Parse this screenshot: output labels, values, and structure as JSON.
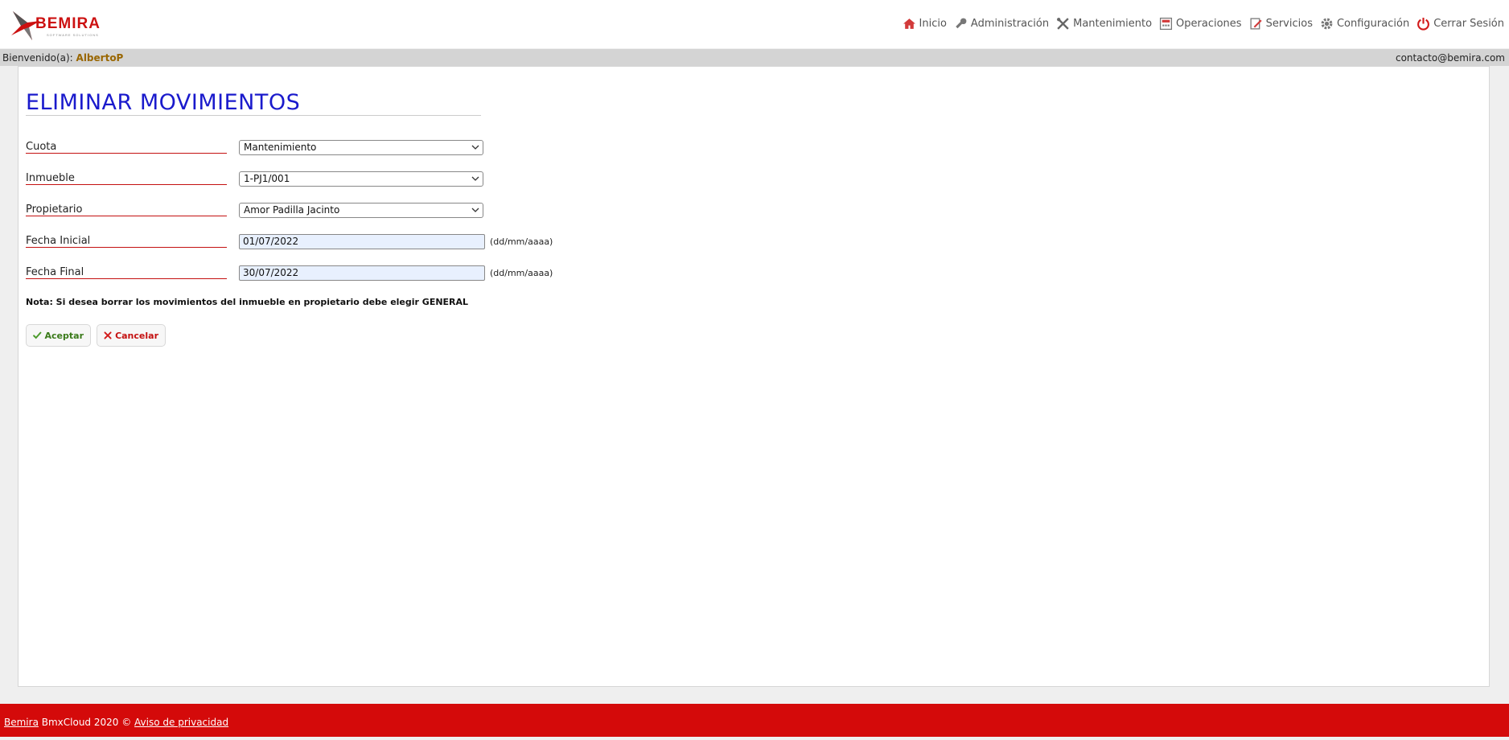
{
  "brand": {
    "logo_text": "BEMIRA",
    "logo_sub": "SOFTWARE SOLUTIONS",
    "accent": "#cc1111"
  },
  "nav": [
    {
      "label": "Inicio",
      "icon": "home-icon"
    },
    {
      "label": "Administración",
      "icon": "key-icon"
    },
    {
      "label": "Mantenimiento",
      "icon": "tools-icon"
    },
    {
      "label": "Operaciones",
      "icon": "calculator-icon"
    },
    {
      "label": "Servicios",
      "icon": "document-pen-icon"
    },
    {
      "label": "Configuración",
      "icon": "gear-icon"
    },
    {
      "label": "Cerrar Sesión",
      "icon": "power-icon"
    }
  ],
  "welcome": {
    "prefix": "Bienvenido(a):",
    "user": "AlbertoP",
    "contact": "contacto@bemira.com"
  },
  "page": {
    "title": "ELIMINAR MOVIMIENTOS"
  },
  "form": {
    "cuota": {
      "label": "Cuota",
      "value": "Mantenimiento"
    },
    "inmueble": {
      "label": "Inmueble",
      "value": "1-PJ1/001"
    },
    "propietario": {
      "label": "Propietario",
      "value": "Amor Padilla Jacinto"
    },
    "fecha_inicial": {
      "label": "Fecha Inicial",
      "value": "01/07/2022",
      "hint": "(dd/mm/aaaa)"
    },
    "fecha_final": {
      "label": "Fecha Final",
      "value": "30/07/2022",
      "hint": "(dd/mm/aaaa)"
    },
    "note": "Nota: Si desea borrar los movimientos del inmueble en propietario debe elegir GENERAL",
    "accept_label": "Aceptar",
    "cancel_label": "Cancelar"
  },
  "footer": {
    "brand_link": "Bemira",
    "copyright": " BmxCloud 2020 © ",
    "privacy_link": "Aviso de privacidad"
  }
}
